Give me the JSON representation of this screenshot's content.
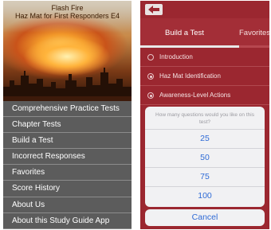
{
  "left_screen": {
    "title_line1": "Flash Fire",
    "title_line2": "Haz Mat for First Responders E4",
    "menu": [
      "Comprehensive Practice Tests",
      "Chapter Tests",
      "Build a Test",
      "Incorrect Responses",
      "Favorites",
      "Score History",
      "About Us",
      "About this Study Guide App"
    ]
  },
  "right_screen": {
    "tabs": [
      "Build a Test",
      "Favorites"
    ],
    "active_tab": "Build a Test",
    "chapters": [
      {
        "label": "Introduction",
        "selected": false
      },
      {
        "label": "Haz Mat Identification",
        "selected": true
      },
      {
        "label": "Awareness-Level Actions",
        "selected": true
      }
    ],
    "dialog": {
      "message": "How many questions would you like on this test?",
      "options": [
        "25",
        "50",
        "75",
        "100"
      ],
      "cancel": "Cancel"
    }
  },
  "colors": {
    "menu_bg": "#5c5c5c",
    "brand_red": "#9b2730",
    "ios_blue": "#2f6bd6"
  }
}
